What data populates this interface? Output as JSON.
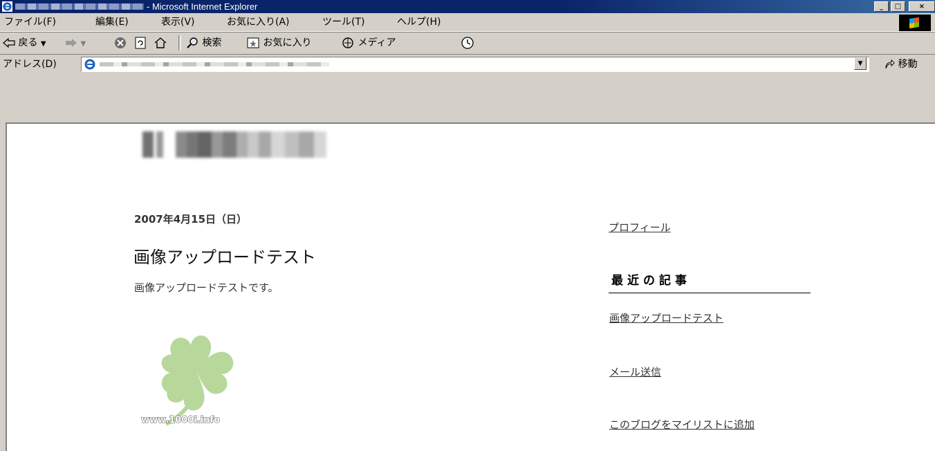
{
  "window": {
    "title_suffix": "- Microsoft Internet Explorer",
    "minimize": "_",
    "maximize": "□",
    "close": "×"
  },
  "menu": [
    "ファイル(F)",
    "編集(E)",
    "表示(V)",
    "お気に入り(A)",
    "ツール(T)",
    "ヘルプ(H)"
  ],
  "toolbar": {
    "back": "戻る",
    "search": "検索",
    "favorites": "お気に入り",
    "media": "メディア"
  },
  "address": {
    "label": "アドレス(D)",
    "go": "移動"
  },
  "post": {
    "date": "2007年4月15日（日）",
    "title": "画像アップロードテスト",
    "body": "画像アップロードテストです。",
    "image_caption": "www.1000i.info"
  },
  "sidebar": {
    "profile": "プロフィール",
    "recent_heading": "最近の記事",
    "recent_item": "画像アップロードテスト",
    "mail": "メール送信",
    "mylist": "このブログをマイリストに追加"
  },
  "colors": {
    "title_bar": "#0a246a",
    "chrome": "#d4d0c8",
    "clover": "#b7d89a"
  }
}
